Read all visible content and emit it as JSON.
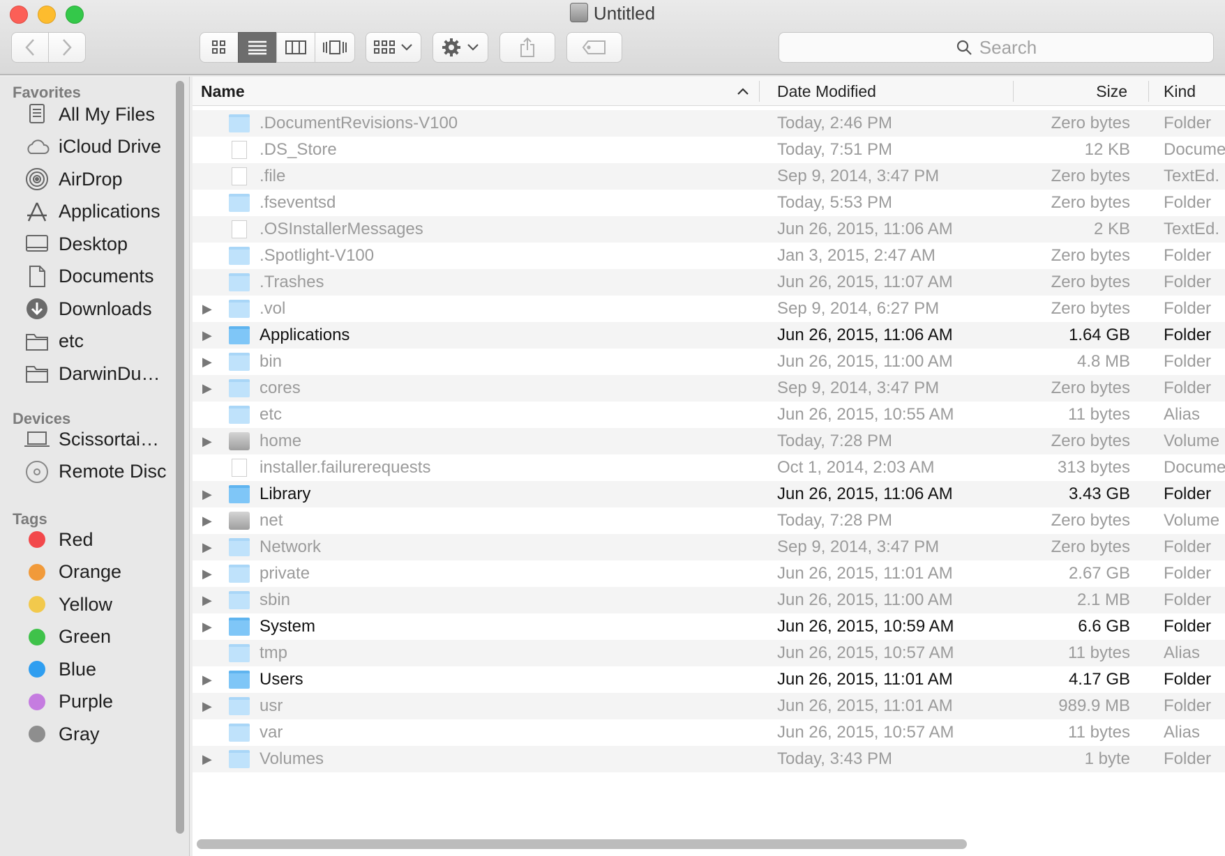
{
  "window": {
    "title": "Untitled"
  },
  "toolbar": {
    "search_placeholder": "Search",
    "views": [
      "icon-view",
      "list-view",
      "column-view",
      "cover-flow-view"
    ],
    "selected_view": "list-view"
  },
  "sidebar": {
    "sections": [
      {
        "heading": "Favorites",
        "items": [
          {
            "label": "All My Files",
            "icon": "all-files-icon"
          },
          {
            "label": "iCloud Drive",
            "icon": "cloud-icon"
          },
          {
            "label": "AirDrop",
            "icon": "airdrop-icon"
          },
          {
            "label": "Applications",
            "icon": "applications-icon"
          },
          {
            "label": "Desktop",
            "icon": "desktop-icon"
          },
          {
            "label": "Documents",
            "icon": "documents-icon"
          },
          {
            "label": "Downloads",
            "icon": "downloads-icon"
          },
          {
            "label": "etc",
            "icon": "folder-icon"
          },
          {
            "label": "DarwinDu…",
            "icon": "folder-icon"
          }
        ]
      },
      {
        "heading": "Devices",
        "items": [
          {
            "label": "Scissortai…",
            "icon": "laptop-icon"
          },
          {
            "label": "Remote Disc",
            "icon": "disc-icon"
          }
        ]
      },
      {
        "heading": "Tags",
        "items": [
          {
            "label": "Red",
            "color": "#f2484b"
          },
          {
            "label": "Orange",
            "color": "#f19a3a"
          },
          {
            "label": "Yellow",
            "color": "#f2c94c"
          },
          {
            "label": "Green",
            "color": "#3fc24a"
          },
          {
            "label": "Blue",
            "color": "#2f9ef0"
          },
          {
            "label": "Purple",
            "color": "#c57ce0"
          },
          {
            "label": "Gray",
            "color": "#8e8e8e"
          }
        ]
      }
    ]
  },
  "columns": {
    "name": "Name",
    "date": "Date Modified",
    "size": "Size",
    "kind": "Kind"
  },
  "files": [
    {
      "name": ".DocumentRevisions-V100",
      "date": "Today, 2:46 PM",
      "size": "Zero bytes",
      "kind": "Folder",
      "icon": "folder-locked-icon",
      "expandable": false,
      "hidden": true
    },
    {
      "name": ".DS_Store",
      "date": "Today, 7:51 PM",
      "size": "12 KB",
      "kind": "Docume",
      "icon": "document-icon",
      "expandable": false,
      "hidden": true
    },
    {
      "name": ".file",
      "date": "Sep 9, 2014, 3:47 PM",
      "size": "Zero bytes",
      "kind": "TextEd.",
      "icon": "document-icon",
      "expandable": false,
      "hidden": true
    },
    {
      "name": ".fseventsd",
      "date": "Today, 5:53 PM",
      "size": "Zero bytes",
      "kind": "Folder",
      "icon": "folder-locked-icon",
      "expandable": false,
      "hidden": true
    },
    {
      "name": ".OSInstallerMessages",
      "date": "Jun 26, 2015, 11:06 AM",
      "size": "2 KB",
      "kind": "TextEd.",
      "icon": "document-icon",
      "expandable": false,
      "hidden": true
    },
    {
      "name": ".Spotlight-V100",
      "date": "Jan 3, 2015, 2:47 AM",
      "size": "Zero bytes",
      "kind": "Folder",
      "icon": "folder-locked-icon",
      "expandable": false,
      "hidden": true
    },
    {
      "name": ".Trashes",
      "date": "Jun 26, 2015, 11:07 AM",
      "size": "Zero bytes",
      "kind": "Folder",
      "icon": "folder-icon",
      "expandable": false,
      "hidden": true
    },
    {
      "name": ".vol",
      "date": "Sep 9, 2014, 6:27 PM",
      "size": "Zero bytes",
      "kind": "Folder",
      "icon": "folder-icon",
      "expandable": true,
      "hidden": true
    },
    {
      "name": "Applications",
      "date": "Jun 26, 2015, 11:06 AM",
      "size": "1.64 GB",
      "kind": "Folder",
      "icon": "folder-icon",
      "expandable": true,
      "hidden": false
    },
    {
      "name": "bin",
      "date": "Jun 26, 2015, 11:00 AM",
      "size": "4.8 MB",
      "kind": "Folder",
      "icon": "folder-icon",
      "expandable": true,
      "hidden": true
    },
    {
      "name": "cores",
      "date": "Sep 9, 2014, 3:47 PM",
      "size": "Zero bytes",
      "kind": "Folder",
      "icon": "folder-icon",
      "expandable": true,
      "hidden": true
    },
    {
      "name": "etc",
      "date": "Jun 26, 2015, 10:55 AM",
      "size": "11 bytes",
      "kind": "Alias",
      "icon": "alias-folder-icon",
      "expandable": false,
      "hidden": true
    },
    {
      "name": "home",
      "date": "Today, 7:28 PM",
      "size": "Zero bytes",
      "kind": "Volume",
      "icon": "volume-icon",
      "expandable": true,
      "hidden": true
    },
    {
      "name": "installer.failurerequests",
      "date": "Oct 1, 2014, 2:03 AM",
      "size": "313 bytes",
      "kind": "Docume",
      "icon": "document-icon",
      "expandable": false,
      "hidden": true
    },
    {
      "name": "Library",
      "date": "Jun 26, 2015, 11:06 AM",
      "size": "3.43 GB",
      "kind": "Folder",
      "icon": "folder-icon",
      "expandable": true,
      "hidden": false
    },
    {
      "name": "net",
      "date": "Today, 7:28 PM",
      "size": "Zero bytes",
      "kind": "Volume",
      "icon": "volume-icon",
      "expandable": true,
      "hidden": true
    },
    {
      "name": "Network",
      "date": "Sep 9, 2014, 3:47 PM",
      "size": "Zero bytes",
      "kind": "Folder",
      "icon": "folder-icon",
      "expandable": true,
      "hidden": true
    },
    {
      "name": "private",
      "date": "Jun 26, 2015, 11:01 AM",
      "size": "2.67 GB",
      "kind": "Folder",
      "icon": "folder-icon",
      "expandable": true,
      "hidden": true
    },
    {
      "name": "sbin",
      "date": "Jun 26, 2015, 11:00 AM",
      "size": "2.1 MB",
      "kind": "Folder",
      "icon": "folder-icon",
      "expandable": true,
      "hidden": true
    },
    {
      "name": "System",
      "date": "Jun 26, 2015, 10:59 AM",
      "size": "6.6 GB",
      "kind": "Folder",
      "icon": "folder-icon",
      "expandable": true,
      "hidden": false
    },
    {
      "name": "tmp",
      "date": "Jun 26, 2015, 10:57 AM",
      "size": "11 bytes",
      "kind": "Alias",
      "icon": "alias-folder-icon",
      "expandable": false,
      "hidden": true
    },
    {
      "name": "Users",
      "date": "Jun 26, 2015, 11:01 AM",
      "size": "4.17 GB",
      "kind": "Folder",
      "icon": "folder-icon",
      "expandable": true,
      "hidden": false
    },
    {
      "name": "usr",
      "date": "Jun 26, 2015, 11:01 AM",
      "size": "989.9 MB",
      "kind": "Folder",
      "icon": "folder-icon",
      "expandable": true,
      "hidden": true
    },
    {
      "name": "var",
      "date": "Jun 26, 2015, 10:57 AM",
      "size": "11 bytes",
      "kind": "Alias",
      "icon": "alias-folder-icon",
      "expandable": false,
      "hidden": true
    },
    {
      "name": "Volumes",
      "date": "Today, 3:43 PM",
      "size": "1 byte",
      "kind": "Folder",
      "icon": "folder-icon",
      "expandable": true,
      "hidden": true
    }
  ],
  "sort": {
    "column": "name",
    "direction": "ascending"
  }
}
